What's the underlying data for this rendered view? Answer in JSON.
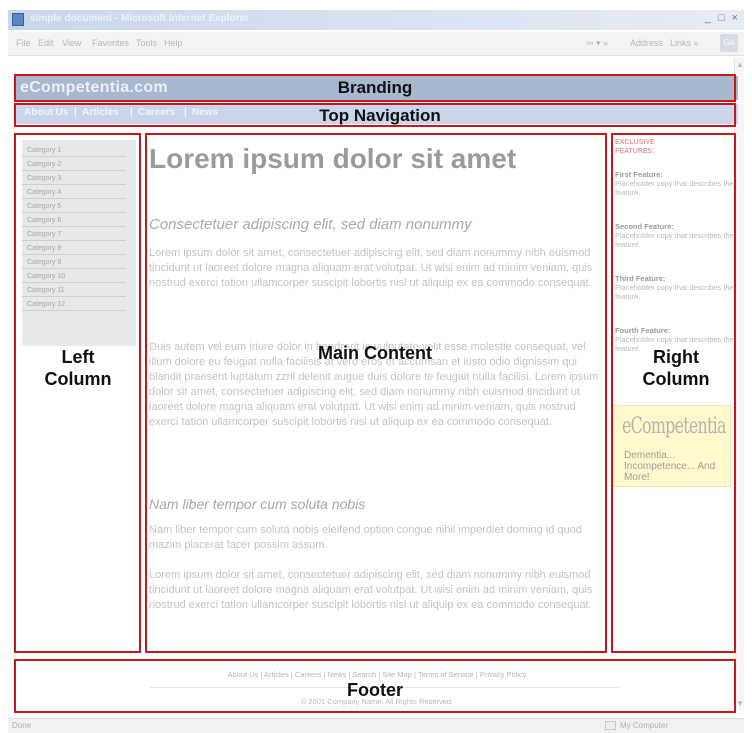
{
  "window": {
    "title": "simple document - Microsoft Internet Explorer",
    "controls": "_ □ ×"
  },
  "menu": {
    "items": [
      "File",
      "Edit",
      "View",
      "Favorites",
      "Tools",
      "Help"
    ],
    "toolbar": [
      "⇦ ▾ »",
      "Address",
      "Links »"
    ],
    "go_label": "Go"
  },
  "site": {
    "name": "eCompetentia.com",
    "nav": [
      "About Us",
      "Articles",
      "Careers",
      "News"
    ],
    "nav_sep": "|"
  },
  "left": {
    "categories": [
      "Category 1",
      "Category 2",
      "Category 3",
      "Category 4",
      "Category 5",
      "Category 6",
      "Category 7",
      "Category 8",
      "Category 9",
      "Category 10",
      "Category 11",
      "Category 12"
    ]
  },
  "main": {
    "heading": "Lorem ipsum dolor sit amet",
    "subheading": "Consectetuer adipiscing elit, sed diam nonummy",
    "para1": "Lorem ipsum dolor sit amet, consectetuer adipiscing elit, sed diam nonummy nibh euismod tincidunt ut laoreet dolore magna aliquam erat volutpat. Ut wisi enim ad minim veniam, quis nostrud exerci tation ullamcorper suscipit lobortis nisl ut aliquip ex ea commodo consequat.",
    "para2": "Duis autem vel eum iriure dolor in hendrerit in vulputate velit esse molestie consequat, vel illum dolore eu feugiat nulla facilisis at vero eros et accumsan et iusto odio dignissim qui blandit praesent luptatum zzril delenit augue duis dolore te feugait nulla facilisi. Lorem ipsum dolor sit amet, consectetuer adipiscing elit, sed diam nonummy nibh euismod tincidunt ut laoreet dolore magna aliquam erat volutpat. Ut wisi enim ad minim veniam, quis nostrud exerci tation ullamcorper suscipit lobortis nisl ut aliquip ex ea commodo consequat.",
    "heading2": "Nam liber tempor cum soluta nobis",
    "para3": "Nam liber tempor cum soluta nobis eleifend option congue nihil imperdiet doming id quod mazim placerat facer possim assum.",
    "para4": "Lorem ipsum dolor sit amet, consectetuer adipiscing elit, sed diam nonummy nibh euismod tincidunt ut laoreet dolore magna aliquam erat volutpat. Ut wisi enim ad minim veniam, quis nostrud exerci tation ullamcorper suscipit lobortis nisl ut aliquip ex ea commodo consequat."
  },
  "right": {
    "exclusive": "EXCLUSIVE FEATURES:",
    "features": [
      {
        "title": "First Feature:",
        "body": "Placeholder copy that describes the feature."
      },
      {
        "title": "Second Feature:",
        "body": "Placeholder copy that describes the feature."
      },
      {
        "title": "Third Feature:",
        "body": "Placeholder copy that describes the feature."
      },
      {
        "title": "Fourth Feature:",
        "body": "Placeholder copy that describes the feature."
      }
    ],
    "ad_logo": "eCompetentia",
    "ad_tagline": "Dementia... Incompetence... And More!"
  },
  "footer": {
    "links": "About Us | Articles | Careers | News | Search | Site Map | Terms of Service | Privacy Policy",
    "copyright": "© 2001 Company Name. All Rights Reserved."
  },
  "status": {
    "left": "Done",
    "zone": "My Computer"
  },
  "labels": {
    "branding": "Branding",
    "top_navigation": "Top Navigation",
    "left_column": "Left Column",
    "main_content": "Main Content",
    "right_column": "Right Column",
    "footer": "Footer"
  },
  "colors": {
    "annotation": "#c8161c",
    "banner": "#a8b8cf",
    "nav": "#c8d5ea"
  }
}
